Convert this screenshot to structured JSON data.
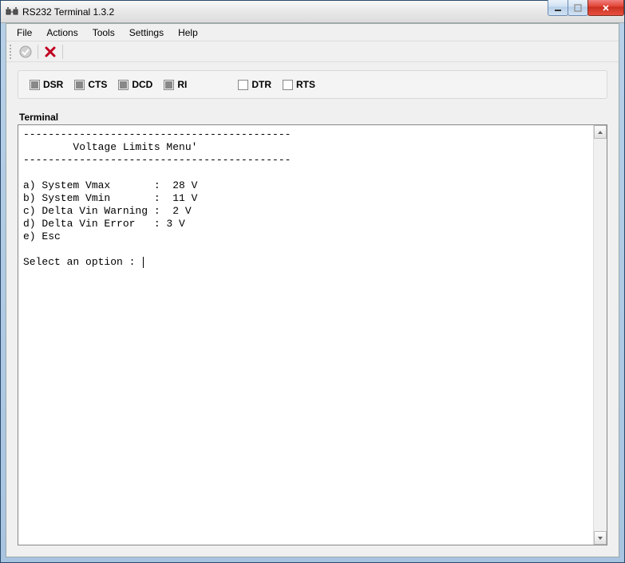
{
  "window": {
    "title": "RS232 Terminal 1.3.2"
  },
  "menu": {
    "items": [
      "File",
      "Actions",
      "Tools",
      "Settings",
      "Help"
    ]
  },
  "signals": {
    "status": [
      {
        "name": "DSR"
      },
      {
        "name": "CTS"
      },
      {
        "name": "DCD"
      },
      {
        "name": "RI"
      }
    ],
    "control": [
      {
        "name": "DTR"
      },
      {
        "name": "RTS"
      }
    ]
  },
  "terminal": {
    "label": "Terminal",
    "divider": "-------------------------------------------",
    "header": "        Voltage Limits Menu'",
    "options": [
      "a) System Vmax       :  28 V",
      "b) System Vmin       :  11 V",
      "c) Delta Vin Warning :  2 V",
      "d) Delta Vin Error   : 3 V",
      "e) Esc"
    ],
    "prompt": "Select an option : "
  }
}
